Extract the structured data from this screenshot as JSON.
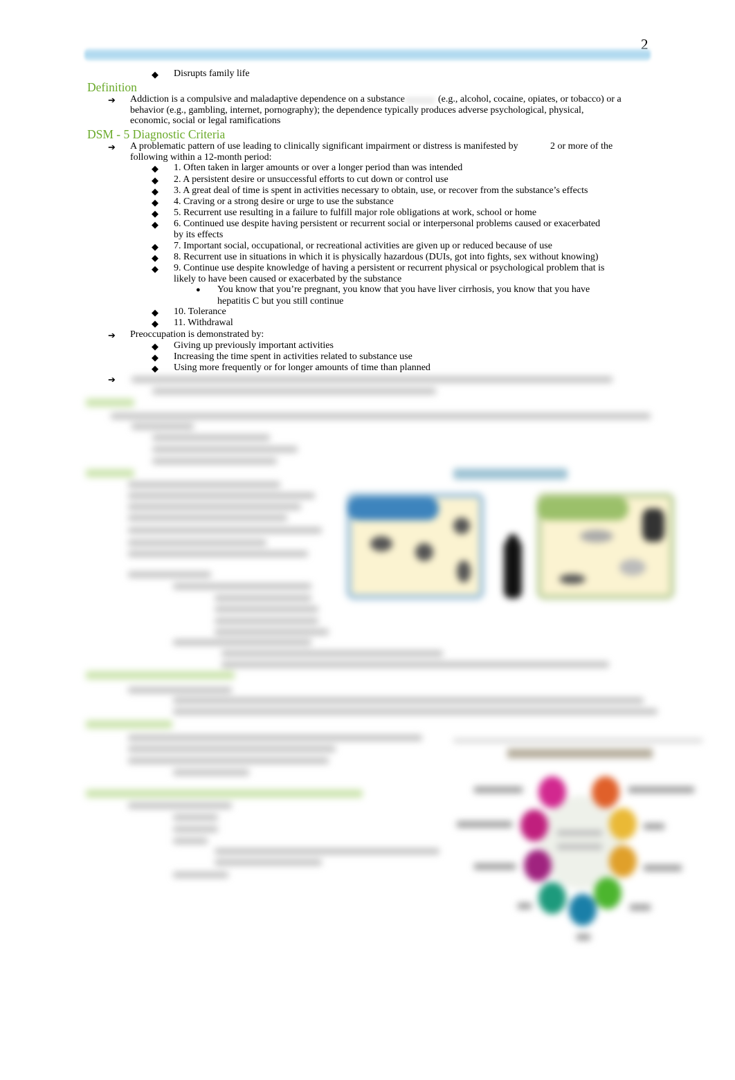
{
  "page": {
    "number": "2"
  },
  "intro_bullet": "Disrupts family life",
  "definition": {
    "heading": "Definition",
    "text_line1_a": "Addiction is a compulsive and maladaptive dependence on a substance",
    "text_line1_b": "(e.g., alcohol, cocaine, opiates, or tobacco) or a",
    "text_line2": "behavior  (e.g., gambling, internet, pornography); the dependence typically produces adverse psychological, physical,",
    "text_line3": "economic, social or legal ramifications"
  },
  "dsm": {
    "heading": "DSM - 5 Diagnostic Criteria",
    "intro_line1_a": "A problematic pattern of use leading to clinically significant impairment or distress is manifested by",
    "intro_line1_b": "2 or more of the",
    "intro_line2": "following within a  12-month   period:",
    "criteria": [
      {
        "lines": [
          "1. Often taken in larger amounts or over a longer period than was intended"
        ]
      },
      {
        "lines": [
          "2. A persistent desire or unsuccessful efforts to cut down or control use"
        ]
      },
      {
        "lines": [
          "3. A great deal of time is spent in activities necessary to obtain, use, or recover from the substance’s effects"
        ]
      },
      {
        "lines": [
          "4. Craving or a strong desire or urge to use the substance"
        ]
      },
      {
        "lines": [
          "5. Recurrent use resulting in a failure to fulfill major role obligations at work, school or home"
        ]
      },
      {
        "lines": [
          "6. Continued use despite having persistent or recurrent social or interpersonal problems caused or exacerbated",
          "by its effects"
        ]
      },
      {
        "lines": [
          "7. Important social, occupational, or recreational activities are given up or reduced because of use"
        ]
      },
      {
        "lines": [
          "8. Recurrent use in situations in which it is physically hazardous (DUIs, got into fights, sex without knowing)"
        ]
      },
      {
        "lines": [
          "9. Continue use despite knowledge of having a persistent or recurrent physical or psychological problem that is",
          "likely to have been caused or exacerbated by the substance"
        ]
      },
      {
        "lines": [
          "10. Tolerance"
        ]
      },
      {
        "lines": [
          "11. Withdrawal"
        ]
      }
    ],
    "criterion9_sub": [
      "You know that you’re pregnant, you know that you have liver cirrhosis, you know that you have",
      "hepatitis C but you still continue"
    ],
    "preoccupation": {
      "intro": "Preoccupation is demonstrated by:",
      "items": [
        "Giving up previously important activities",
        "Increasing the time spent in activities related to substance use",
        "Using more frequently or for longer amounts of time than planned"
      ]
    }
  },
  "icons": {
    "arrow": "➔",
    "diamond": "◆",
    "dot": "●"
  },
  "colors": {
    "heading_green": "#6aaa2a",
    "header_bar_blue": "#a9d6ee"
  }
}
